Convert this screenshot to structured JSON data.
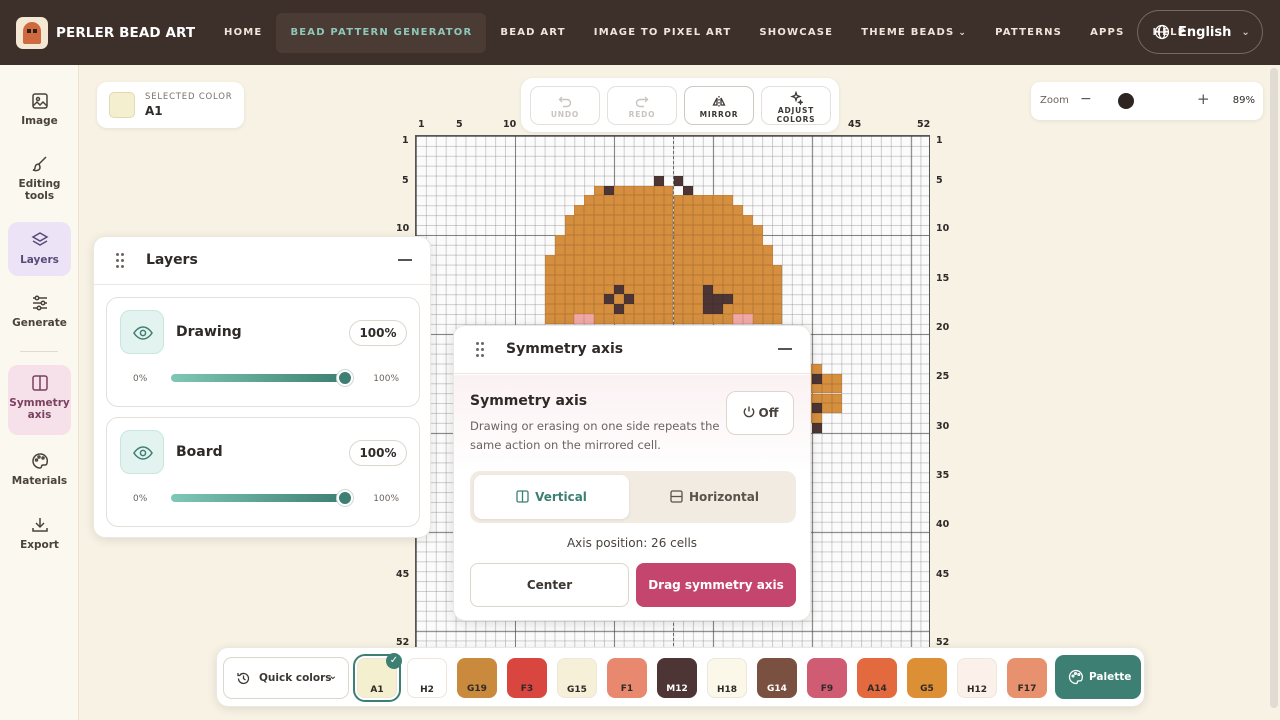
{
  "brand": {
    "name": "PERLER BEAD ART"
  },
  "nav": {
    "items": [
      {
        "label": "HOME"
      },
      {
        "label": "BEAD PATTERN GENERATOR",
        "active": true
      },
      {
        "label": "BEAD ART"
      },
      {
        "label": "IMAGE TO PIXEL ART"
      },
      {
        "label": "SHOWCASE"
      },
      {
        "label": "THEME BEADS",
        "has_dropdown": true
      },
      {
        "label": "PATTERNS"
      },
      {
        "label": "APPS"
      },
      {
        "label": "HELP"
      }
    ],
    "language": "English"
  },
  "sidebar": {
    "items": [
      {
        "label": "Image",
        "icon": "image-icon"
      },
      {
        "label": "Editing tools",
        "icon": "brush-icon"
      },
      {
        "label": "Layers",
        "icon": "layers-icon",
        "active": true
      },
      {
        "label": "Generate",
        "icon": "sliders-icon"
      },
      {
        "label": "Symmetry axis",
        "icon": "split-square-icon",
        "active": true
      },
      {
        "label": "Materials",
        "icon": "palette-icon"
      },
      {
        "label": "Export",
        "icon": "download-icon"
      }
    ]
  },
  "selected_color": {
    "label": "SELECTED COLOR",
    "value": "A1",
    "swatch": "#f4efcf"
  },
  "toolbar": {
    "undo": "UNDO",
    "redo": "REDO",
    "mirror": "MIRROR",
    "adjust_line1": "ADJUST",
    "adjust_line2": "COLORS"
  },
  "zoom": {
    "label": "Zoom",
    "minus": "−",
    "plus": "+",
    "value": "89%",
    "level": 0.89
  },
  "board": {
    "grid_size": 52,
    "top_numbers": [
      "1",
      "5",
      "10",
      "45",
      "52"
    ],
    "left_numbers": [
      "1",
      "5",
      "10",
      "45",
      "52"
    ],
    "right_numbers": [
      "1",
      "5",
      "10",
      "15",
      "20",
      "25",
      "30",
      "35",
      "40",
      "45",
      "52"
    ],
    "colors": {
      "body": "#d58f3f",
      "dark": "#4d3535",
      "pink": "#f2a9a6"
    }
  },
  "layers_panel": {
    "title": "Layers",
    "layers": [
      {
        "name": "Drawing",
        "percent": "100%",
        "min": "0%",
        "max": "100%",
        "value": 1.0
      },
      {
        "name": "Board",
        "percent": "100%",
        "min": "0%",
        "max": "100%",
        "value": 1.0
      }
    ]
  },
  "symmetry_panel": {
    "title": "Symmetry axis",
    "heading": "Symmetry axis",
    "description": "Drawing or erasing on one side repeats the same action on the mirrored cell.",
    "toggle": "Off",
    "vertical": "Vertical",
    "horizontal": "Horizontal",
    "axis_position": "Axis position: 26 cells",
    "center": "Center",
    "drag": "Drag symmetry axis"
  },
  "palette_bar": {
    "quick_colors": "Quick colors",
    "palette_button": "Palette",
    "swatches": [
      {
        "code": "A1",
        "color": "#f4efcf",
        "text": "#2e2a27",
        "selected": true
      },
      {
        "code": "H2",
        "color": "#ffffff",
        "text": "#2e2a27"
      },
      {
        "code": "G19",
        "color": "#c98a3e",
        "text": "#2e2a27"
      },
      {
        "code": "F3",
        "color": "#d9453f",
        "text": "#2e2a27"
      },
      {
        "code": "G15",
        "color": "#f6f0d8",
        "text": "#2e2a27"
      },
      {
        "code": "F1",
        "color": "#e8896f",
        "text": "#2e2a27"
      },
      {
        "code": "M12",
        "color": "#4d3535",
        "text": "#ffffff"
      },
      {
        "code": "H18",
        "color": "#fbf8ea",
        "text": "#2e2a27"
      },
      {
        "code": "G14",
        "color": "#7a5140",
        "text": "#ffffff"
      },
      {
        "code": "F9",
        "color": "#cf5c72",
        "text": "#2e2a27"
      },
      {
        "code": "A14",
        "color": "#e36a3f",
        "text": "#2e2a27"
      },
      {
        "code": "G5",
        "color": "#dc8f34",
        "text": "#2e2a27"
      },
      {
        "code": "H12",
        "color": "#fbf1ea",
        "text": "#2e2a27"
      },
      {
        "code": "F17",
        "color": "#e8916f",
        "text": "#2e2a27"
      }
    ]
  }
}
